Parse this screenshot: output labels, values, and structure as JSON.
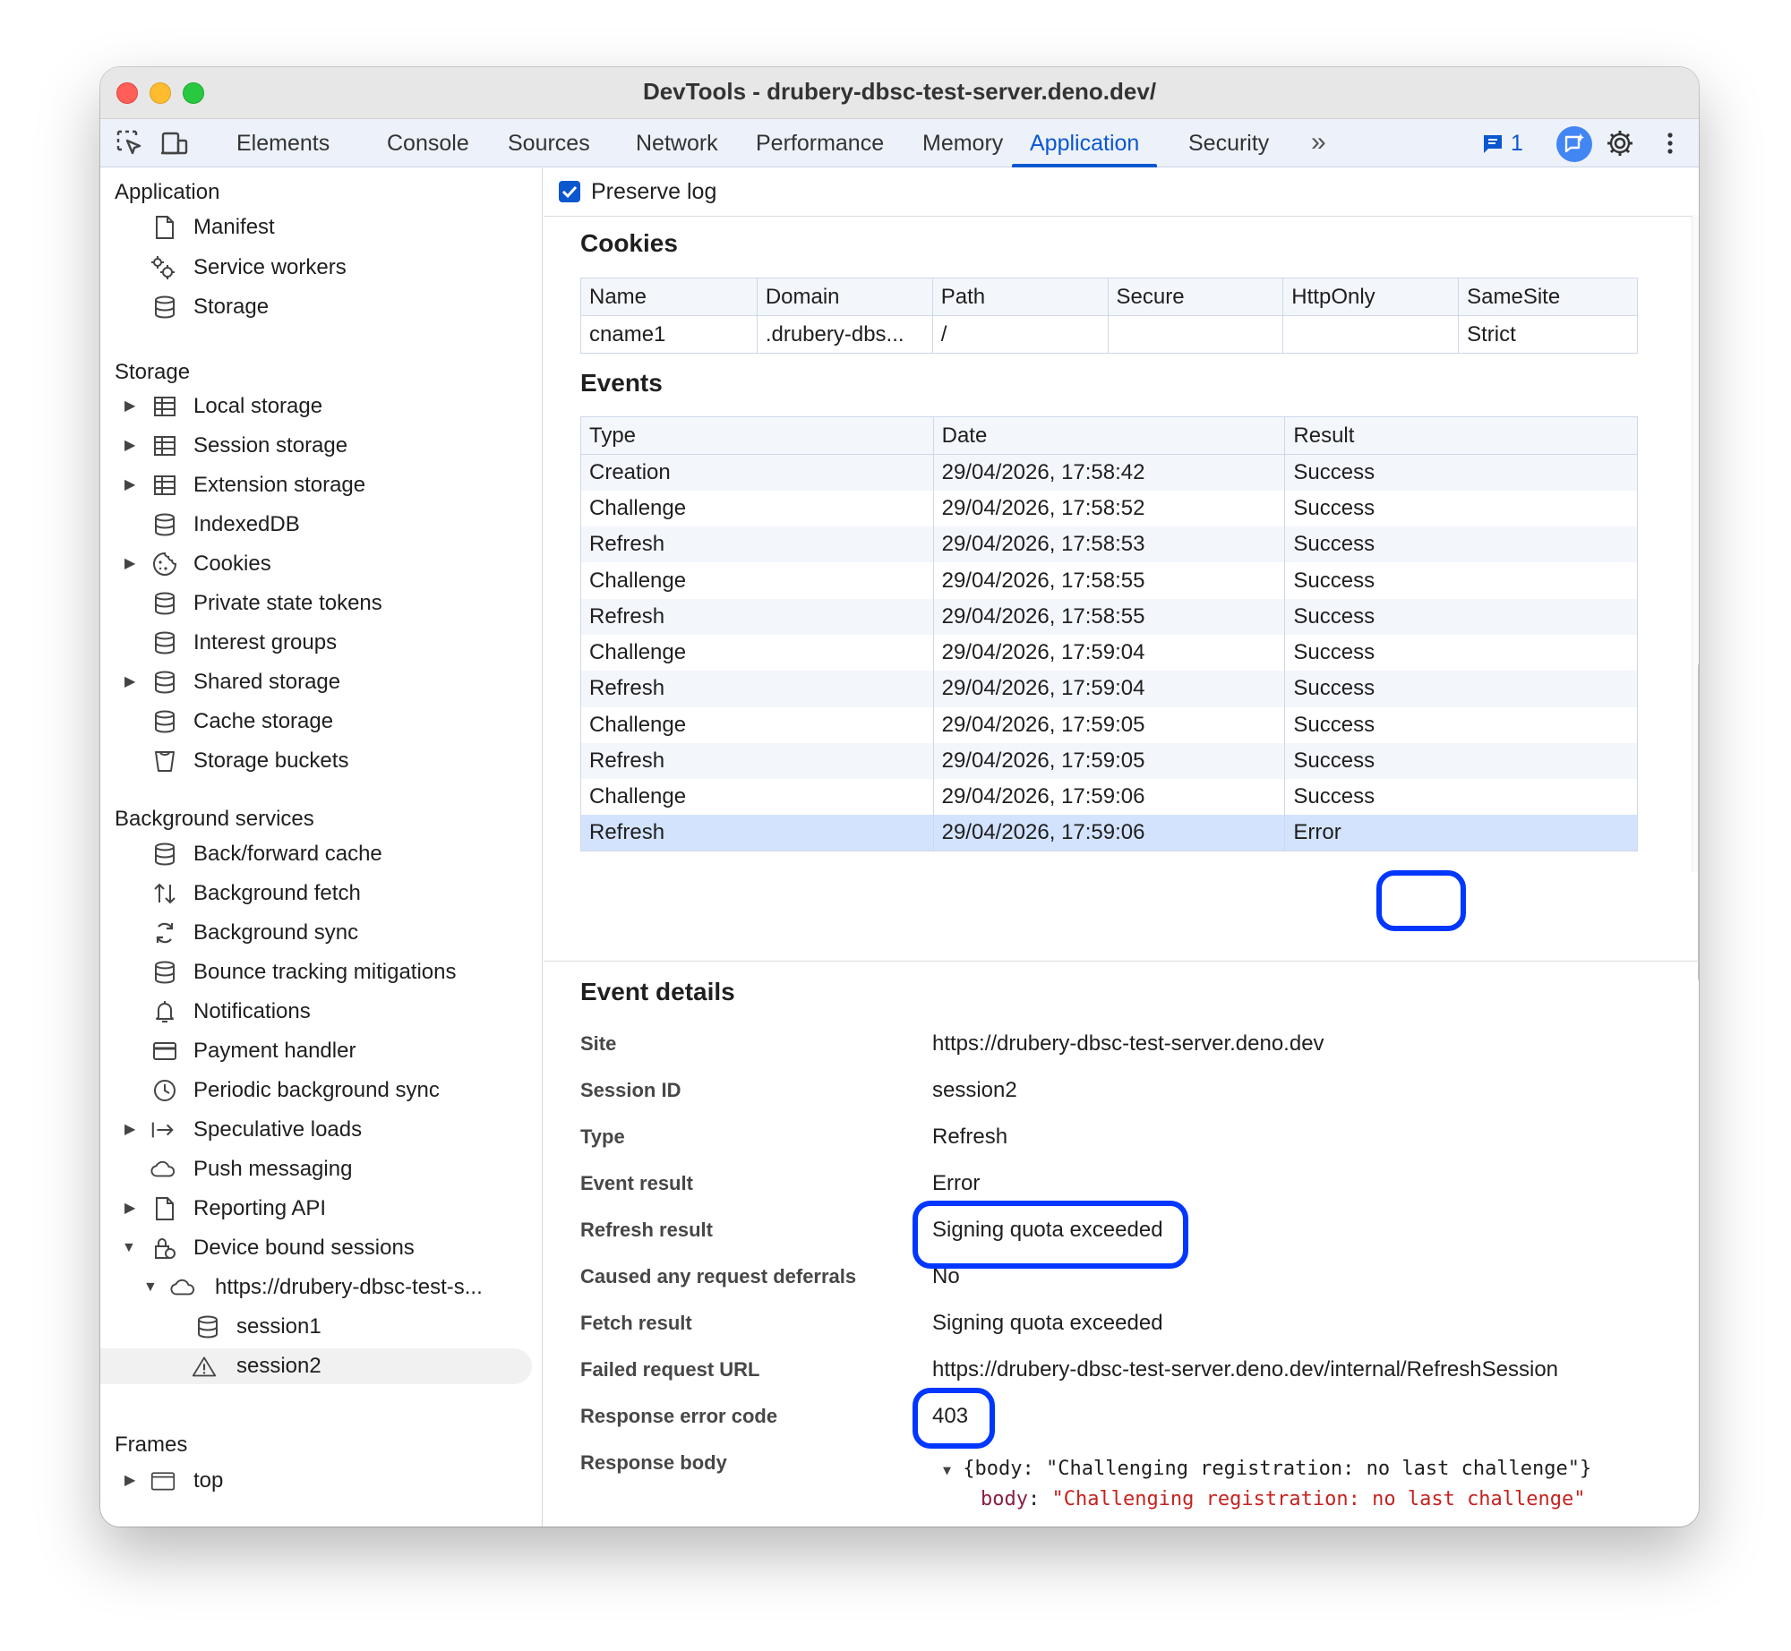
{
  "window": {
    "title": "DevTools - drubery-dbsc-test-server.deno.dev/"
  },
  "toolbar": {
    "tabs": [
      "Elements",
      "Console",
      "Sources",
      "Network",
      "Performance",
      "Memory",
      "Application",
      "Security"
    ],
    "active_tab": "Application",
    "more_tabs": "»",
    "issues_count": "1"
  },
  "sidebar": {
    "application_header": "Application",
    "application_items": [
      "Manifest",
      "Service workers",
      "Storage"
    ],
    "storage_header": "Storage",
    "storage_items": [
      "Local storage",
      "Session storage",
      "Extension storage",
      "IndexedDB",
      "Cookies",
      "Private state tokens",
      "Interest groups",
      "Shared storage",
      "Cache storage",
      "Storage buckets"
    ],
    "background_header": "Background services",
    "background_items": [
      "Back/forward cache",
      "Background fetch",
      "Background sync",
      "Bounce tracking mitigations",
      "Notifications",
      "Payment handler",
      "Periodic background sync",
      "Speculative loads",
      "Push messaging",
      "Reporting API",
      "Device bound sessions"
    ],
    "dbsc_site": "https://drubery-dbsc-test-s...",
    "sessions": [
      "session1",
      "session2"
    ],
    "frames_header": "Frames",
    "frames_items": [
      "top"
    ]
  },
  "main": {
    "preserve_log_label": "Preserve log",
    "cookies_title": "Cookies",
    "cookies_headers": [
      "Name",
      "Domain",
      "Path",
      "Secure",
      "HttpOnly",
      "SameSite"
    ],
    "cookies_rows": [
      [
        "cname1",
        ".drubery-dbs...",
        "/",
        "",
        "",
        "Strict"
      ]
    ],
    "events_title": "Events",
    "events_headers": [
      "Type",
      "Date",
      "Result"
    ],
    "events_rows": [
      [
        "Creation",
        "29/04/2026, 17:58:42",
        "Success"
      ],
      [
        "Challenge",
        "29/04/2026, 17:58:52",
        "Success"
      ],
      [
        "Refresh",
        "29/04/2026, 17:58:53",
        "Success"
      ],
      [
        "Challenge",
        "29/04/2026, 17:58:55",
        "Success"
      ],
      [
        "Refresh",
        "29/04/2026, 17:58:55",
        "Success"
      ],
      [
        "Challenge",
        "29/04/2026, 17:59:04",
        "Success"
      ],
      [
        "Refresh",
        "29/04/2026, 17:59:04",
        "Success"
      ],
      [
        "Challenge",
        "29/04/2026, 17:59:05",
        "Success"
      ],
      [
        "Refresh",
        "29/04/2026, 17:59:05",
        "Success"
      ],
      [
        "Challenge",
        "29/04/2026, 17:59:06",
        "Success"
      ],
      [
        "Refresh",
        "29/04/2026, 17:59:06",
        "Error"
      ]
    ],
    "details_title": "Event details",
    "details": [
      {
        "label": "Site",
        "value": "https://drubery-dbsc-test-server.deno.dev"
      },
      {
        "label": "Session ID",
        "value": "session2"
      },
      {
        "label": "Type",
        "value": "Refresh"
      },
      {
        "label": "Event result",
        "value": "Error"
      },
      {
        "label": "Refresh result",
        "value": "Signing quota exceeded"
      },
      {
        "label": "Caused any request deferrals",
        "value": "No"
      },
      {
        "label": "Fetch result",
        "value": "Signing quota exceeded"
      },
      {
        "label": "Failed request URL",
        "value": "https://drubery-dbsc-test-server.deno.dev/internal/RefreshSession"
      },
      {
        "label": "Response error code",
        "value": "403"
      },
      {
        "label": "Response body",
        "value": ""
      }
    ],
    "response_body_summary": "{body: \"Challenging registration: no last challenge\"}",
    "response_body_key": "body",
    "response_body_value": "\"Challenging registration: no last challenge\""
  },
  "colors": {
    "accent": "#0b57d0",
    "highlight": "#0037ff",
    "selected_row": "#d3e3fd"
  }
}
